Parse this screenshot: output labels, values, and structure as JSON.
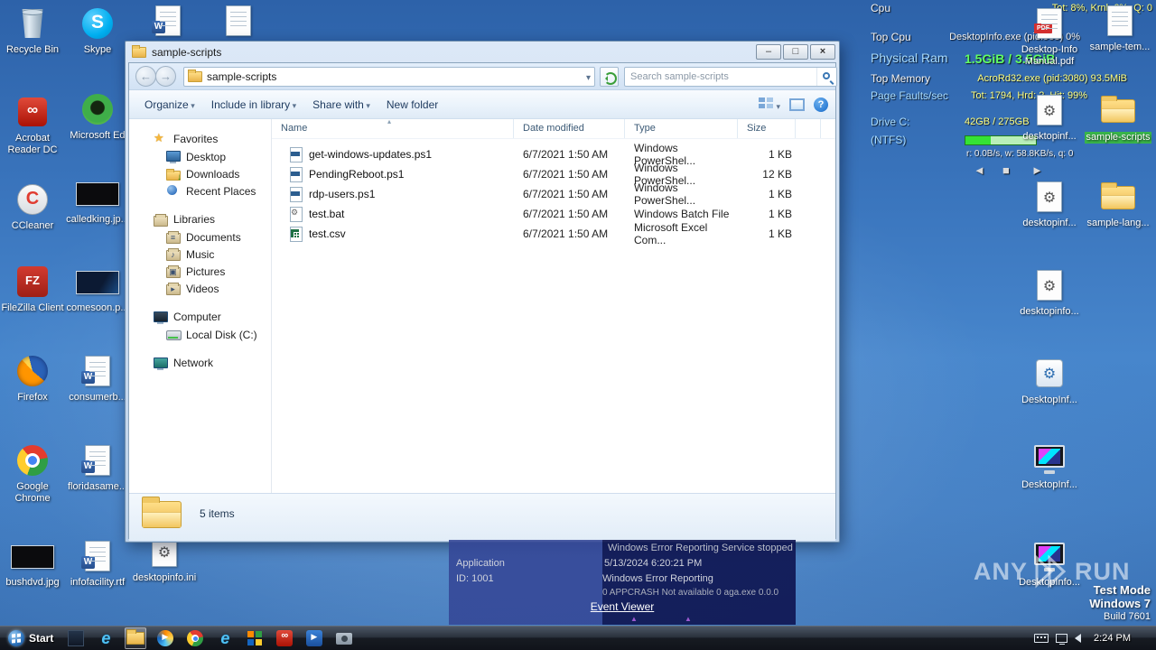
{
  "desktop": {
    "left_icons": [
      {
        "label": "Recycle Bin",
        "icon": "recycle-bin"
      },
      {
        "label": "Acrobat Reader DC",
        "icon": "acrobat-reader"
      },
      {
        "label": "CCleaner",
        "icon": "ccleaner"
      },
      {
        "label": "FileZilla Client",
        "icon": "filezilla"
      },
      {
        "label": "Firefox",
        "icon": "firefox"
      },
      {
        "label": "Google Chrome",
        "icon": "chrome"
      },
      {
        "label": "bushdvd.jpg",
        "icon": "image-thumbnail"
      },
      {
        "label": "Skype",
        "icon": "skype"
      },
      {
        "label": "Microsoft Ed",
        "icon": "edge"
      },
      {
        "label": "calledking.jp...",
        "icon": "image-thumbnail"
      },
      {
        "label": "comesoon.p...",
        "icon": "image-thumbnail"
      },
      {
        "label": "consumerb...",
        "icon": "word-document"
      },
      {
        "label": "floridasame...",
        "icon": "word-document"
      },
      {
        "label": "infofacility.rtf",
        "icon": "word-document"
      },
      {
        "label": "desktopinfo.ini",
        "icon": "gear-document"
      }
    ],
    "right_icons": [
      {
        "label": "Desktop-Info Manual.pdf",
        "icon": "pdf-document"
      },
      {
        "label": "sample-tem...",
        "icon": "text-document"
      },
      {
        "label": "desktopinf...",
        "icon": "gear-document"
      },
      {
        "label": "sample-scripts",
        "icon": "folder"
      },
      {
        "label": "desktopinf...",
        "icon": "gear-document"
      },
      {
        "label": "sample-lang...",
        "icon": "folder"
      },
      {
        "label": "desktopinfo...",
        "icon": "gear-document"
      },
      {
        "label": "DesktopInf...",
        "icon": "gear-app"
      },
      {
        "label": "DesktopInf...",
        "icon": "monitor-app"
      },
      {
        "label": "DesktopInfo...",
        "icon": "monitor-app"
      }
    ]
  },
  "explorer": {
    "title": "sample-scripts",
    "address": "sample-scripts",
    "search_placeholder": "Search sample-scripts",
    "toolbar": {
      "organize": "Organize",
      "include_in_library": "Include in library",
      "share_with": "Share with",
      "new_folder": "New folder"
    },
    "nav": {
      "favorites_label": "Favorites",
      "favorites": [
        "Desktop",
        "Downloads",
        "Recent Places"
      ],
      "libraries_label": "Libraries",
      "libraries": [
        "Documents",
        "Music",
        "Pictures",
        "Videos"
      ],
      "computer_label": "Computer",
      "computer": [
        "Local Disk (C:)"
      ],
      "network_label": "Network"
    },
    "columns": {
      "name": "Name",
      "date": "Date modified",
      "type": "Type",
      "size": "Size"
    },
    "files": [
      {
        "name": "get-windows-updates.ps1",
        "date": "6/7/2021 1:50 AM",
        "type": "Windows PowerShel...",
        "size": "1 KB",
        "icon": "powershell-script"
      },
      {
        "name": "PendingReboot.ps1",
        "date": "6/7/2021 1:50 AM",
        "type": "Windows PowerShel...",
        "size": "12 KB",
        "icon": "powershell-script"
      },
      {
        "name": "rdp-users.ps1",
        "date": "6/7/2021 1:50 AM",
        "type": "Windows PowerShel...",
        "size": "1 KB",
        "icon": "powershell-script"
      },
      {
        "name": "test.bat",
        "date": "6/7/2021 1:50 AM",
        "type": "Windows Batch File",
        "size": "1 KB",
        "icon": "batch-file"
      },
      {
        "name": "test.csv",
        "date": "6/7/2021 1:50 AM",
        "type": "Microsoft Excel Com...",
        "size": "1 KB",
        "icon": "excel-csv"
      }
    ],
    "status": "5 items"
  },
  "desktopinfo": {
    "cpu_label": "Cpu",
    "cpu_value": "Tot: 8%, Krnl: 6%, Q: 0",
    "top_cpu_label": "Top Cpu",
    "top_cpu_value": "DesktopInfo.exe (pid:968) 0%",
    "ram_label": "Physical Ram",
    "ram_value": "1.5GiB / 3.5GiB",
    "top_mem_label": "Top Memory",
    "top_mem_value": "AcroRd32.exe (pid:3080) 93.5MiB",
    "pf_label": "Page Faults/sec",
    "pf_value": "Tot: 1794, Hrd: 2, Hit: 99%",
    "drive_label": "Drive C:",
    "drive_value": "42GB / 275GB",
    "fs_label": "(NTFS)",
    "io_value": "r: 0.0B/s, w: 58.8KB/s, q: 0"
  },
  "event_overlay": {
    "service_text": "Windows Error Reporting Service stopped",
    "log_name": "Application",
    "event_id": "ID: 1001",
    "timestamp": "5/13/2024 6:20:21 PM",
    "source": "Windows Error Reporting",
    "details": "0 APPCRASH Not available 0 aga.exe 0.0.0",
    "link": "Event Viewer"
  },
  "watermark": {
    "brand_left": "ANY",
    "brand_right": "RUN"
  },
  "system_badge": {
    "mode": "Test Mode",
    "os": "Windows 7",
    "build": "Build 7601"
  },
  "taskbar": {
    "start_label": "Start",
    "clock": "2:24 PM"
  },
  "colors": {
    "di_value_yellow": "#ffff7e",
    "di_value_green": "#62ff62",
    "di_label_blue": "#a8dcff",
    "selection_green": "#39b54a",
    "folder_yellow": "#e9b44a"
  },
  "icons": {
    "search": "magnifier",
    "refresh": "circular-green-arrows",
    "chevron_down": "▾",
    "sort_ascending": "▴",
    "gear": "⚙",
    "favorites_star": "★",
    "media_controls": "◄ ■ ►"
  }
}
